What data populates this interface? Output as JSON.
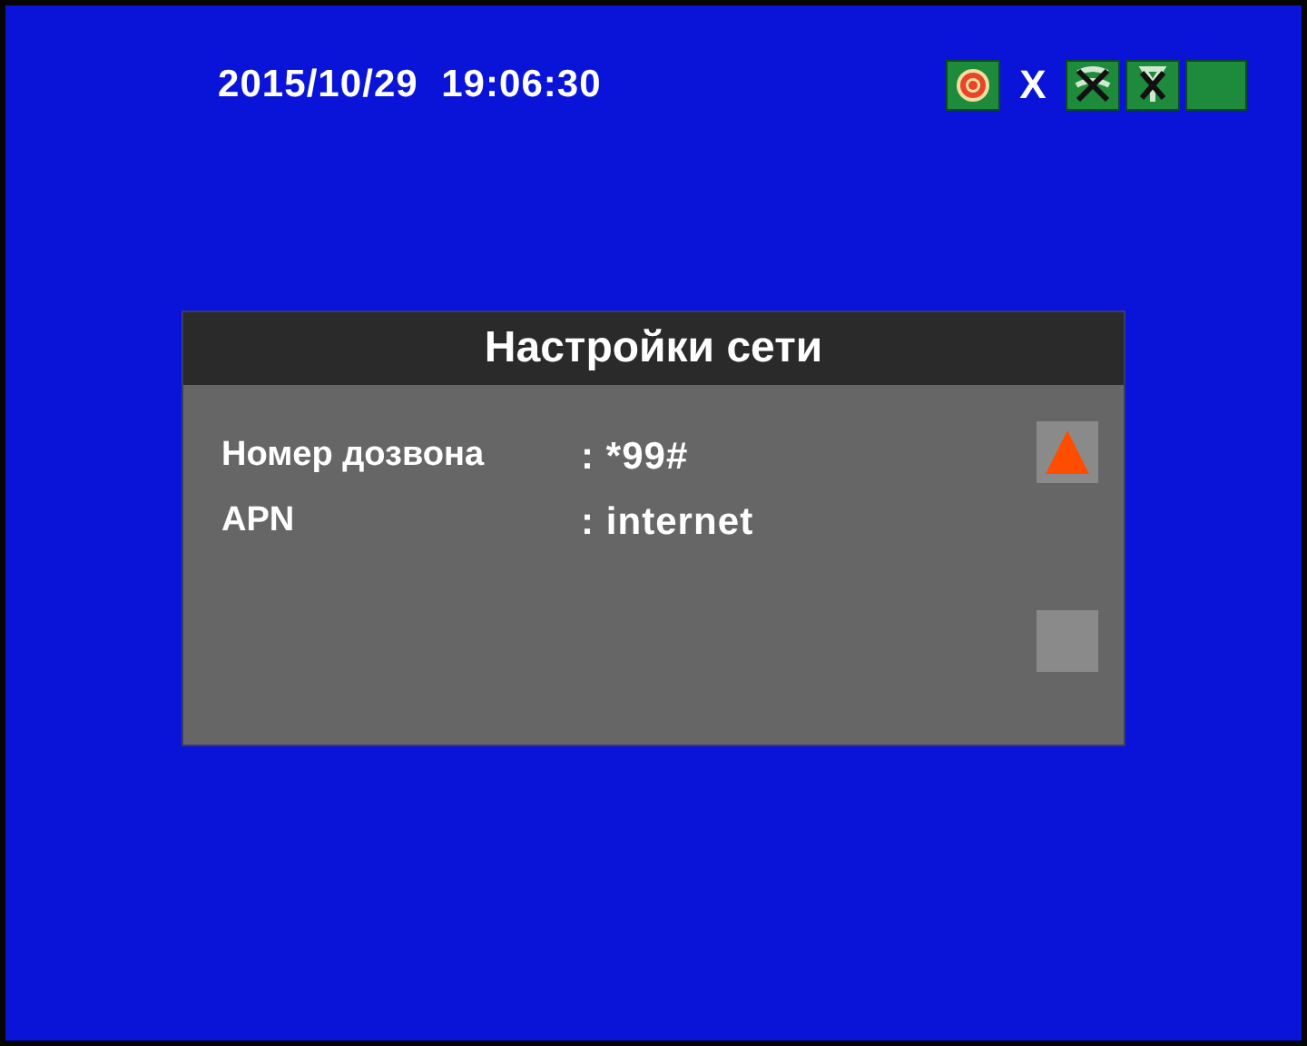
{
  "datetime": "2015/10/29  19:06:30",
  "status_icons": [
    {
      "kind": "record"
    },
    {
      "kind": "text",
      "text": "X"
    },
    {
      "kind": "crossed-signal"
    },
    {
      "kind": "crossed-antenna"
    },
    {
      "kind": "empty"
    }
  ],
  "dialog": {
    "title": "Настройки сети",
    "rows": [
      {
        "label": "Номер дозвона",
        "value": ": *99#"
      },
      {
        "label": "APN",
        "value": ": internet"
      }
    ]
  }
}
